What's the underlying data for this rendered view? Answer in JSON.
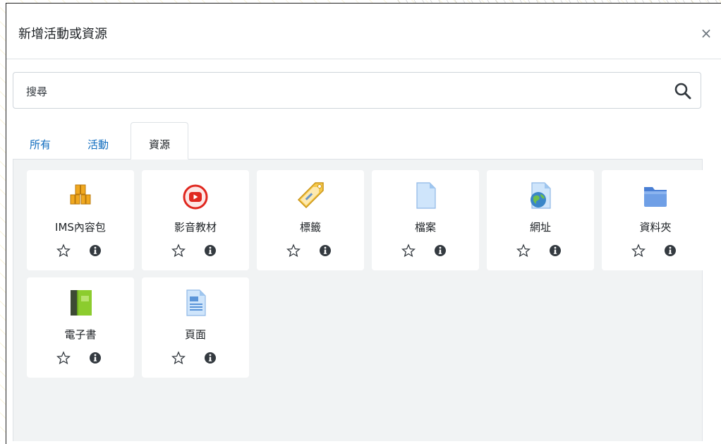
{
  "modal": {
    "title": "新增活動或資源",
    "close_label": "×"
  },
  "search": {
    "placeholder": "搜尋"
  },
  "tabs": [
    {
      "label": "所有"
    },
    {
      "label": "活動"
    },
    {
      "label": "資源"
    }
  ],
  "active_tab": "資源",
  "items": [
    {
      "label": "IMS內容包",
      "icon": "package-icon"
    },
    {
      "label": "影音教材",
      "icon": "video-icon"
    },
    {
      "label": "標籤",
      "icon": "label-tag-icon"
    },
    {
      "label": "檔案",
      "icon": "file-icon"
    },
    {
      "label": "網址",
      "icon": "url-icon"
    },
    {
      "label": "資料夾",
      "icon": "folder-icon"
    },
    {
      "label": "電子書",
      "icon": "book-icon"
    },
    {
      "label": "頁面",
      "icon": "page-icon"
    }
  ],
  "colors": {
    "link": "#0f6cbf",
    "content_bg": "#f1f3f4",
    "video_red": "#e0271f"
  }
}
